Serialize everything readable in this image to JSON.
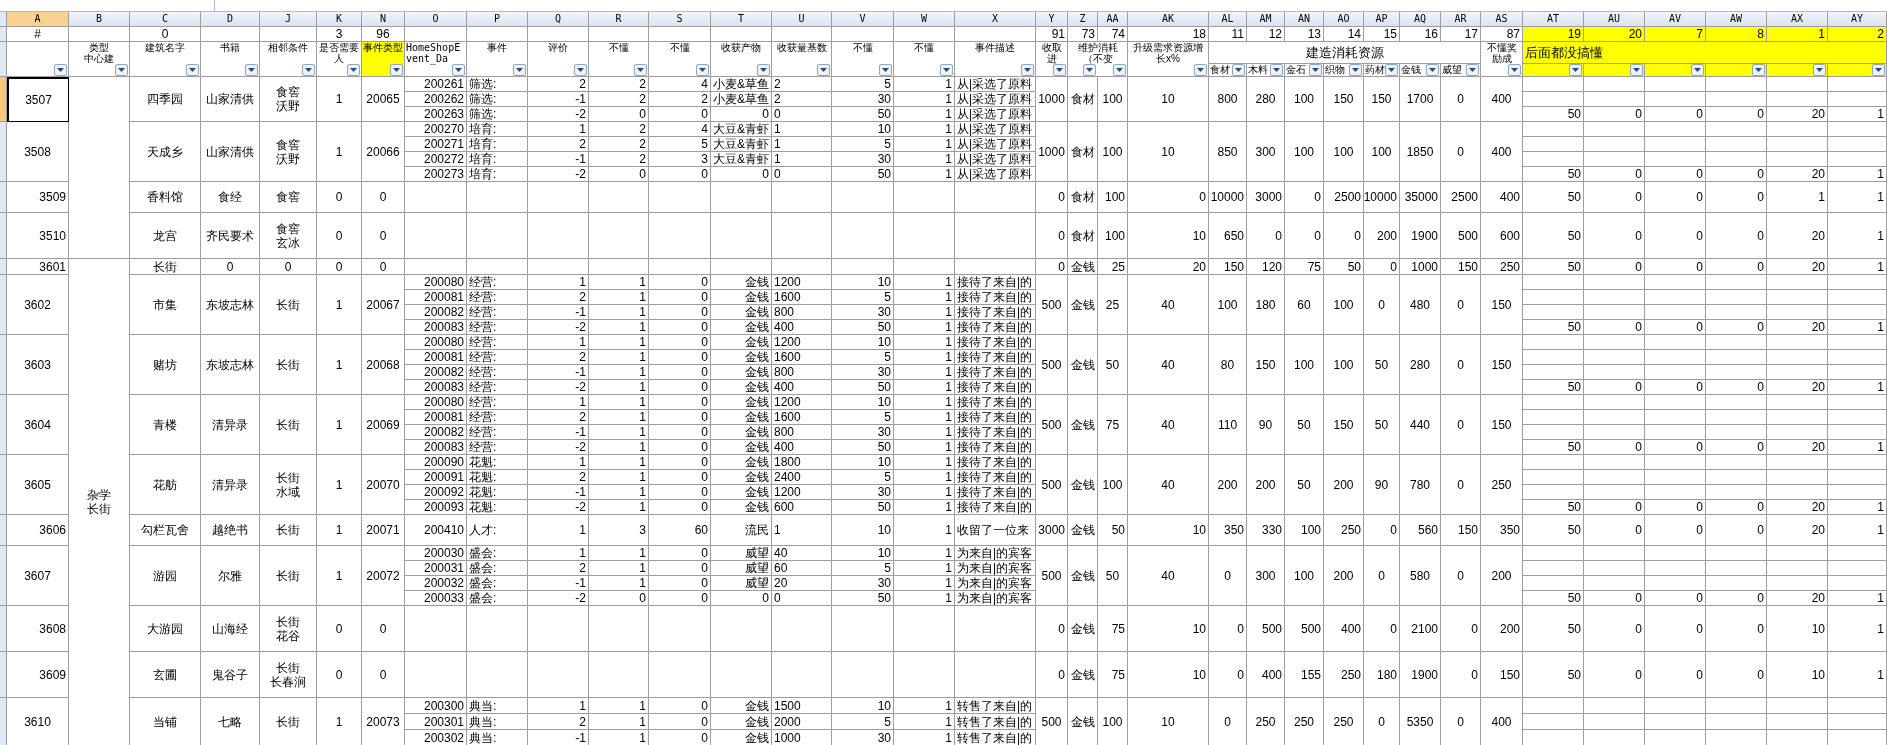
{
  "columns": [
    {
      "letter": "A",
      "selected": true,
      "index": "#",
      "index_highlighted": false,
      "header_highlighted": false
    },
    {
      "letter": "B",
      "selected": false,
      "header": [
        "类型",
        "中心建"
      ],
      "index_highlighted": false,
      "header_highlighted": false
    },
    {
      "letter": "C",
      "selected": false,
      "index": "0",
      "header": "建筑名字",
      "index_highlighted": false,
      "header_highlighted": false
    },
    {
      "letter": "D",
      "selected": false,
      "header": "书籍",
      "index_highlighted": false,
      "header_highlighted": false
    },
    {
      "letter": "J",
      "selected": false,
      "header": "相邻条件",
      "index_highlighted": false,
      "header_highlighted": false
    },
    {
      "letter": "K",
      "selected": false,
      "index": "3",
      "header": "是否需要人",
      "index_highlighted": false,
      "header_highlighted": false
    },
    {
      "letter": "N",
      "selected": false,
      "index": "96",
      "header": "事件类型",
      "index_highlighted": false,
      "header_highlighted": true
    },
    {
      "letter": "O",
      "selected": false,
      "header": "HomeShopEvent_Da",
      "index_highlighted": false,
      "header_highlighted": false
    },
    {
      "letter": "P",
      "selected": false,
      "header": "事件",
      "index_highlighted": false,
      "header_highlighted": false
    },
    {
      "letter": "Q",
      "selected": false,
      "header": "评价",
      "index_highlighted": false,
      "header_highlighted": false
    },
    {
      "letter": "R",
      "selected": false,
      "header": "不懂",
      "index_highlighted": false,
      "header_highlighted": false
    },
    {
      "letter": "S",
      "selected": false,
      "header": "不懂",
      "index_highlighted": false,
      "header_highlighted": false
    },
    {
      "letter": "T",
      "selected": false,
      "header": "收获产物",
      "index_highlighted": false,
      "header_highlighted": false
    },
    {
      "letter": "U",
      "selected": false,
      "header": "收获量基数",
      "index_highlighted": false,
      "header_highlighted": false
    },
    {
      "letter": "V",
      "selected": false,
      "header": "不懂",
      "index_highlighted": false,
      "header_highlighted": false
    },
    {
      "letter": "W",
      "selected": false,
      "header": "不懂",
      "index_highlighted": false,
      "header_highlighted": false
    },
    {
      "letter": "X",
      "selected": false,
      "header": "事件描述",
      "index_highlighted": false,
      "header_highlighted": false
    },
    {
      "letter": "Y",
      "selected": false,
      "index": "91",
      "header": "收取进",
      "index_highlighted": false,
      "header_highlighted": false
    },
    {
      "letter": "Z",
      "selected": false,
      "index": "73",
      "header": "维护消耗（不变",
      "index_highlighted": false,
      "header_highlighted": false
    },
    {
      "letter": "AA",
      "selected": false,
      "index": "74",
      "index_highlighted": false,
      "header_highlighted": false
    },
    {
      "letter": "AK",
      "selected": false,
      "index": "18",
      "header": "升级需求资源增长x%",
      "index_highlighted": false,
      "header_highlighted": false
    },
    {
      "letter": "AL",
      "selected": false,
      "index": "11",
      "header": "食材",
      "index_highlighted": false,
      "header_highlighted": false
    },
    {
      "letter": "AM",
      "selected": false,
      "index": "12",
      "header": "木料",
      "index_highlighted": false,
      "header_highlighted": false
    },
    {
      "letter": "AN",
      "selected": false,
      "index": "13",
      "header": "金石",
      "index_highlighted": false,
      "header_highlighted": false
    },
    {
      "letter": "AO",
      "selected": false,
      "index": "14",
      "header": "织物",
      "index_highlighted": false,
      "header_highlighted": false
    },
    {
      "letter": "AP",
      "selected": false,
      "index": "15",
      "header": "药材",
      "index_highlighted": false,
      "header_highlighted": false
    },
    {
      "letter": "AQ",
      "selected": false,
      "index": "16",
      "header": "金钱",
      "index_highlighted": false,
      "header_highlighted": false
    },
    {
      "letter": "AR",
      "selected": false,
      "index": "17",
      "header": "威望",
      "index_highlighted": false,
      "header_highlighted": false
    },
    {
      "letter": "AS",
      "selected": false,
      "index": "87",
      "header": "不懂奖励成",
      "index_highlighted": false,
      "header_highlighted": false
    },
    {
      "letter": "AT",
      "selected": false,
      "index": "19",
      "index_highlighted": true,
      "header_highlighted": true
    },
    {
      "letter": "AU",
      "selected": false,
      "index": "20",
      "index_highlighted": true,
      "header_highlighted": true
    },
    {
      "letter": "AV",
      "selected": false,
      "index": "7",
      "index_highlighted": true,
      "header_highlighted": true
    },
    {
      "letter": "AW",
      "selected": false,
      "index": "8",
      "index_highlighted": true,
      "header_highlighted": true
    },
    {
      "letter": "AX",
      "selected": false,
      "index": "1",
      "index_highlighted": true,
      "header_highlighted": true
    },
    {
      "letter": "AY",
      "selected": false,
      "index": "2",
      "index_highlighted": true,
      "header_highlighted": true
    }
  ],
  "header_groups": [
    {
      "label": "建造消耗资源",
      "highlighted": false
    },
    {
      "label": "后面都没搞懂",
      "highlighted": true
    }
  ],
  "groups": [
    {
      "id": "3507",
      "selected": true,
      "name": "四季园",
      "book": "山家清供",
      "adjacent": [
        "食窖",
        "沃野"
      ],
      "needs_person": "1",
      "event_type": "20065",
      "events": [
        {
          "id": "200261",
          "event": "筛选:",
          "rating": "2",
          "column_r": "2",
          "column_s": "4",
          "product": "小麦&草鱼",
          "base": "2",
          "column_v": "5",
          "column_w": "1",
          "description": "从|采选了原料"
        },
        {
          "id": "200262",
          "event": "筛选:",
          "rating": "-1",
          "column_r": "2",
          "column_s": "2",
          "product": "小麦&草鱼",
          "base": "2",
          "column_v": "30",
          "column_w": "1",
          "description": "从|采选了原料"
        },
        {
          "id": "200263",
          "event": "筛选:",
          "rating": "-2",
          "column_r": "0",
          "column_s": "0",
          "product": "0",
          "base": "0",
          "column_v": "50",
          "column_w": "1",
          "description": "从|采选了原料"
        }
      ],
      "income": "1000",
      "upkeep": "食材",
      "upkeep_amount": "100",
      "growth": "10",
      "food": "800",
      "wood": "280",
      "stone": "100",
      "cloth": "150",
      "medicine": "150",
      "money": "1700",
      "prestige": "0",
      "reward": "400",
      "tail": [
        "50",
        "0",
        "0",
        "0",
        "20",
        "1"
      ]
    },
    {
      "id": "3508",
      "selected": false,
      "name": "天成乡",
      "book": "山家清供",
      "adjacent": [
        "食窖",
        "沃野"
      ],
      "needs_person": "1",
      "event_type": "20066",
      "events": [
        {
          "id": "200270",
          "event": "培育:",
          "rating": "1",
          "column_r": "2",
          "column_s": "4",
          "product": "大豆&青虾",
          "base": "1",
          "column_v": "10",
          "column_w": "1",
          "description": "从|采选了原料"
        },
        {
          "id": "200271",
          "event": "培育:",
          "rating": "2",
          "column_r": "2",
          "column_s": "5",
          "product": "大豆&青虾",
          "base": "1",
          "column_v": "5",
          "column_w": "1",
          "description": "从|采选了原料"
        },
        {
          "id": "200272",
          "event": "培育:",
          "rating": "-1",
          "column_r": "2",
          "column_s": "3",
          "product": "大豆&青虾",
          "base": "1",
          "column_v": "30",
          "column_w": "1",
          "description": "从|采选了原料"
        },
        {
          "id": "200273",
          "event": "培育:",
          "rating": "-2",
          "column_r": "0",
          "column_s": "0",
          "product": "0",
          "base": "0",
          "column_v": "50",
          "column_w": "1",
          "description": "从|采选了原料"
        }
      ],
      "income": "1000",
      "upkeep": "食材",
      "upkeep_amount": "100",
      "growth": "10",
      "food": "850",
      "wood": "300",
      "stone": "100",
      "cloth": "100",
      "medicine": "100",
      "money": "1850",
      "prestige": "0",
      "reward": "400",
      "tail": [
        "50",
        "0",
        "0",
        "0",
        "20",
        "1"
      ]
    },
    {
      "id": "3509",
      "selected": false,
      "name": "香料馆",
      "book": "食经",
      "adjacent": "食窖",
      "needs_person": "0",
      "event_type": "0",
      "income": "0",
      "upkeep": "食材",
      "upkeep_amount": "100",
      "growth": "0",
      "food": "10000",
      "wood": "3000",
      "stone": "0",
      "cloth": "2500",
      "medicine": "10000",
      "money": "35000",
      "prestige": "2500",
      "reward": "400",
      "tail": [
        "50",
        "0",
        "0",
        "0",
        "1",
        "1"
      ]
    },
    {
      "id": "3510",
      "selected": false,
      "name": "龙宫",
      "book": "齐民要术",
      "adjacent": [
        "食窖",
        "玄冰"
      ],
      "needs_person": "0",
      "event_type": "0",
      "income": "0",
      "upkeep": "食材",
      "upkeep_amount": "100",
      "growth": "10",
      "food": "650",
      "wood": "0",
      "stone": "0",
      "cloth": "0",
      "medicine": "200",
      "money": "1900",
      "prestige": "500",
      "reward": "600",
      "tail": [
        "50",
        "0",
        "0",
        "0",
        "20",
        "1"
      ]
    },
    {
      "id": "3601",
      "selected": false,
      "category": [
        "杂学",
        "长街"
      ],
      "name": "长街",
      "book": "0",
      "adjacent": "0",
      "needs_person": "0",
      "event_type": "0",
      "income": "0",
      "upkeep": "金钱",
      "upkeep_amount": "25",
      "growth": "20",
      "food": "150",
      "wood": "120",
      "stone": "75",
      "cloth": "50",
      "medicine": "0",
      "money": "1000",
      "prestige": "150",
      "reward": "250",
      "tail": [
        "50",
        "0",
        "0",
        "0",
        "20",
        "1"
      ]
    },
    {
      "id": "3602",
      "selected": false,
      "name": "市集",
      "book": "东坡志林",
      "adjacent": "长街",
      "needs_person": "1",
      "event_type": "20067",
      "events": [
        {
          "id": "200080",
          "event": "经营:",
          "rating": "1",
          "column_r": "1",
          "column_s": "0",
          "product": "金钱",
          "base": "1200",
          "column_v": "10",
          "column_w": "1",
          "description": "接待了来自|的"
        },
        {
          "id": "200081",
          "event": "经营:",
          "rating": "2",
          "column_r": "1",
          "column_s": "0",
          "product": "金钱",
          "base": "1600",
          "column_v": "5",
          "column_w": "1",
          "description": "接待了来自|的"
        },
        {
          "id": "200082",
          "event": "经营:",
          "rating": "-1",
          "column_r": "1",
          "column_s": "0",
          "product": "金钱",
          "base": "800",
          "column_v": "30",
          "column_w": "1",
          "description": "接待了来自|的"
        },
        {
          "id": "200083",
          "event": "经营:",
          "rating": "-2",
          "column_r": "1",
          "column_s": "0",
          "product": "金钱",
          "base": "400",
          "column_v": "50",
          "column_w": "1",
          "description": "接待了来自|的"
        }
      ],
      "income": "500",
      "upkeep": "金钱",
      "upkeep_amount": "25",
      "growth": "40",
      "food": "100",
      "wood": "180",
      "stone": "60",
      "cloth": "100",
      "medicine": "0",
      "money": "480",
      "prestige": "0",
      "reward": "150",
      "tail": [
        "50",
        "0",
        "0",
        "0",
        "20",
        "1"
      ]
    },
    {
      "id": "3603",
      "selected": false,
      "name": "赌坊",
      "book": "东坡志林",
      "adjacent": "长街",
      "needs_person": "1",
      "event_type": "20068",
      "events": [
        {
          "id": "200080",
          "event": "经营:",
          "rating": "1",
          "column_r": "1",
          "column_s": "0",
          "product": "金钱",
          "base": "1200",
          "column_v": "10",
          "column_w": "1",
          "description": "接待了来自|的"
        },
        {
          "id": "200081",
          "event": "经营:",
          "rating": "2",
          "column_r": "1",
          "column_s": "0",
          "product": "金钱",
          "base": "1600",
          "column_v": "5",
          "column_w": "1",
          "description": "接待了来自|的"
        },
        {
          "id": "200082",
          "event": "经营:",
          "rating": "-1",
          "column_r": "1",
          "column_s": "0",
          "product": "金钱",
          "base": "800",
          "column_v": "30",
          "column_w": "1",
          "description": "接待了来自|的"
        },
        {
          "id": "200083",
          "event": "经营:",
          "rating": "-2",
          "column_r": "1",
          "column_s": "0",
          "product": "金钱",
          "base": "400",
          "column_v": "50",
          "column_w": "1",
          "description": "接待了来自|的"
        }
      ],
      "income": "500",
      "upkeep": "金钱",
      "upkeep_amount": "50",
      "growth": "40",
      "food": "80",
      "wood": "150",
      "stone": "100",
      "cloth": "100",
      "medicine": "50",
      "money": "280",
      "prestige": "0",
      "reward": "150",
      "tail": [
        "50",
        "0",
        "0",
        "0",
        "20",
        "1"
      ]
    },
    {
      "id": "3604",
      "selected": false,
      "name": "青楼",
      "book": "清异录",
      "adjacent": "长街",
      "needs_person": "1",
      "event_type": "20069",
      "events": [
        {
          "id": "200080",
          "event": "经营:",
          "rating": "1",
          "column_r": "1",
          "column_s": "0",
          "product": "金钱",
          "base": "1200",
          "column_v": "10",
          "column_w": "1",
          "description": "接待了来自|的"
        },
        {
          "id": "200081",
          "event": "经营:",
          "rating": "2",
          "column_r": "1",
          "column_s": "0",
          "product": "金钱",
          "base": "1600",
          "column_v": "5",
          "column_w": "1",
          "description": "接待了来自|的"
        },
        {
          "id": "200082",
          "event": "经营:",
          "rating": "-1",
          "column_r": "1",
          "column_s": "0",
          "product": "金钱",
          "base": "800",
          "column_v": "30",
          "column_w": "1",
          "description": "接待了来自|的"
        },
        {
          "id": "200083",
          "event": "经营:",
          "rating": "-2",
          "column_r": "1",
          "column_s": "0",
          "product": "金钱",
          "base": "400",
          "column_v": "50",
          "column_w": "1",
          "description": "接待了来自|的"
        }
      ],
      "income": "500",
      "upkeep": "金钱",
      "upkeep_amount": "75",
      "growth": "40",
      "food": "110",
      "wood": "90",
      "stone": "50",
      "cloth": "150",
      "medicine": "50",
      "money": "440",
      "prestige": "0",
      "reward": "150",
      "tail": [
        "50",
        "0",
        "0",
        "0",
        "20",
        "1"
      ]
    },
    {
      "id": "3605",
      "selected": false,
      "name": "花舫",
      "book": "清异录",
      "adjacent": [
        "长街",
        "水域"
      ],
      "needs_person": "1",
      "event_type": "20070",
      "events": [
        {
          "id": "200090",
          "event": "花魁:",
          "rating": "1",
          "column_r": "1",
          "column_s": "0",
          "product": "金钱",
          "base": "1800",
          "column_v": "10",
          "column_w": "1",
          "description": "接待了来自|的"
        },
        {
          "id": "200091",
          "event": "花魁:",
          "rating": "2",
          "column_r": "1",
          "column_s": "0",
          "product": "金钱",
          "base": "2400",
          "column_v": "5",
          "column_w": "1",
          "description": "接待了来自|的"
        },
        {
          "id": "200092",
          "event": "花魁:",
          "rating": "-1",
          "column_r": "1",
          "column_s": "0",
          "product": "金钱",
          "base": "1200",
          "column_v": "30",
          "column_w": "1",
          "description": "接待了来自|的"
        },
        {
          "id": "200093",
          "event": "花魁:",
          "rating": "-2",
          "column_r": "1",
          "column_s": "0",
          "product": "金钱",
          "base": "600",
          "column_v": "50",
          "column_w": "1",
          "description": "接待了来自|的"
        }
      ],
      "income": "500",
      "upkeep": "金钱",
      "upkeep_amount": "100",
      "growth": "40",
      "food": "200",
      "wood": "200",
      "stone": "50",
      "cloth": "200",
      "medicine": "90",
      "money": "780",
      "prestige": "0",
      "reward": "250",
      "tail": [
        "50",
        "0",
        "0",
        "0",
        "20",
        "1"
      ]
    },
    {
      "id": "3606",
      "selected": false,
      "name": "勾栏瓦舍",
      "book": "越绝书",
      "adjacent": "长街",
      "needs_person": "1",
      "event_type": "20071",
      "events": [
        {
          "id": "200410",
          "event": "人才:",
          "rating": "1",
          "column_r": "3",
          "column_s": "60",
          "product": "流民",
          "base": "1",
          "column_v": "10",
          "column_w": "1",
          "description": "收留了一位来"
        }
      ],
      "income": "3000",
      "upkeep": "金钱",
      "upkeep_amount": "50",
      "growth": "10",
      "food": "350",
      "wood": "330",
      "stone": "100",
      "cloth": "250",
      "medicine": "0",
      "money": "560",
      "prestige": "150",
      "reward": "350",
      "tail": [
        "50",
        "0",
        "0",
        "0",
        "20",
        "1"
      ]
    },
    {
      "id": "3607",
      "selected": false,
      "name": "游园",
      "book": "尔雅",
      "adjacent": "长街",
      "needs_person": "1",
      "event_type": "20072",
      "events": [
        {
          "id": "200030",
          "event": "盛会:",
          "rating": "1",
          "column_r": "1",
          "column_s": "0",
          "product": "威望",
          "base": "40",
          "column_v": "10",
          "column_w": "1",
          "description": "为来自|的宾客"
        },
        {
          "id": "200031",
          "event": "盛会:",
          "rating": "2",
          "column_r": "1",
          "column_s": "0",
          "product": "威望",
          "base": "60",
          "column_v": "5",
          "column_w": "1",
          "description": "为来自|的宾客"
        },
        {
          "id": "200032",
          "event": "盛会:",
          "rating": "-1",
          "column_r": "1",
          "column_s": "0",
          "product": "威望",
          "base": "20",
          "column_v": "30",
          "column_w": "1",
          "description": "为来自|的宾客"
        },
        {
          "id": "200033",
          "event": "盛会:",
          "rating": "-2",
          "column_r": "0",
          "column_s": "0",
          "product": "0",
          "base": "0",
          "column_v": "50",
          "column_w": "1",
          "description": "为来自|的宾客"
        }
      ],
      "income": "500",
      "upkeep": "金钱",
      "upkeep_amount": "50",
      "growth": "40",
      "food": "0",
      "wood": "300",
      "stone": "100",
      "cloth": "200",
      "medicine": "0",
      "money": "580",
      "prestige": "0",
      "reward": "200",
      "tail": [
        "50",
        "0",
        "0",
        "0",
        "20",
        "1"
      ]
    },
    {
      "id": "3608",
      "selected": false,
      "name": "大游园",
      "book": "山海经",
      "adjacent": [
        "长街",
        "花谷"
      ],
      "needs_person": "0",
      "event_type": "0",
      "income": "0",
      "upkeep": "金钱",
      "upkeep_amount": "75",
      "growth": "10",
      "food": "0",
      "wood": "500",
      "stone": "500",
      "cloth": "400",
      "medicine": "0",
      "money": "2100",
      "prestige": "0",
      "reward": "200",
      "tail": [
        "50",
        "0",
        "0",
        "0",
        "10",
        "1"
      ]
    },
    {
      "id": "3609",
      "selected": false,
      "name": "玄圃",
      "book": "鬼谷子",
      "adjacent": [
        "长街",
        "长春涧"
      ],
      "needs_person": "0",
      "event_type": "0",
      "income": "0",
      "upkeep": "金钱",
      "upkeep_amount": "75",
      "growth": "10",
      "food": "0",
      "wood": "400",
      "stone": "155",
      "cloth": "250",
      "medicine": "180",
      "money": "1900",
      "prestige": "0",
      "reward": "150",
      "tail": [
        "50",
        "0",
        "0",
        "0",
        "10",
        "1"
      ]
    },
    {
      "id": "3610",
      "selected": false,
      "name": "当铺",
      "book": "七略",
      "adjacent": "长街",
      "needs_person": "1",
      "event_type": "20073",
      "events": [
        {
          "id": "200300",
          "event": "典当:",
          "rating": "1",
          "column_r": "1",
          "column_s": "0",
          "product": "金钱",
          "base": "1500",
          "column_v": "10",
          "column_w": "1",
          "description": "转售了来自|的"
        },
        {
          "id": "200301",
          "event": "典当:",
          "rating": "2",
          "column_r": "1",
          "column_s": "0",
          "product": "金钱",
          "base": "2000",
          "column_v": "5",
          "column_w": "1",
          "description": "转售了来自|的"
        },
        {
          "id": "200302",
          "event": "典当:",
          "rating": "-1",
          "column_r": "1",
          "column_s": "0",
          "product": "金钱",
          "base": "1000",
          "column_v": "30",
          "column_w": "1",
          "description": "转售了来自|的"
        }
      ],
      "income": "500",
      "upkeep": "金钱",
      "upkeep_amount": "100",
      "growth": "10",
      "food": "0",
      "wood": "250",
      "stone": "250",
      "cloth": "250",
      "medicine": "0",
      "money": "5350",
      "prestige": "0",
      "reward": "400"
    }
  ]
}
